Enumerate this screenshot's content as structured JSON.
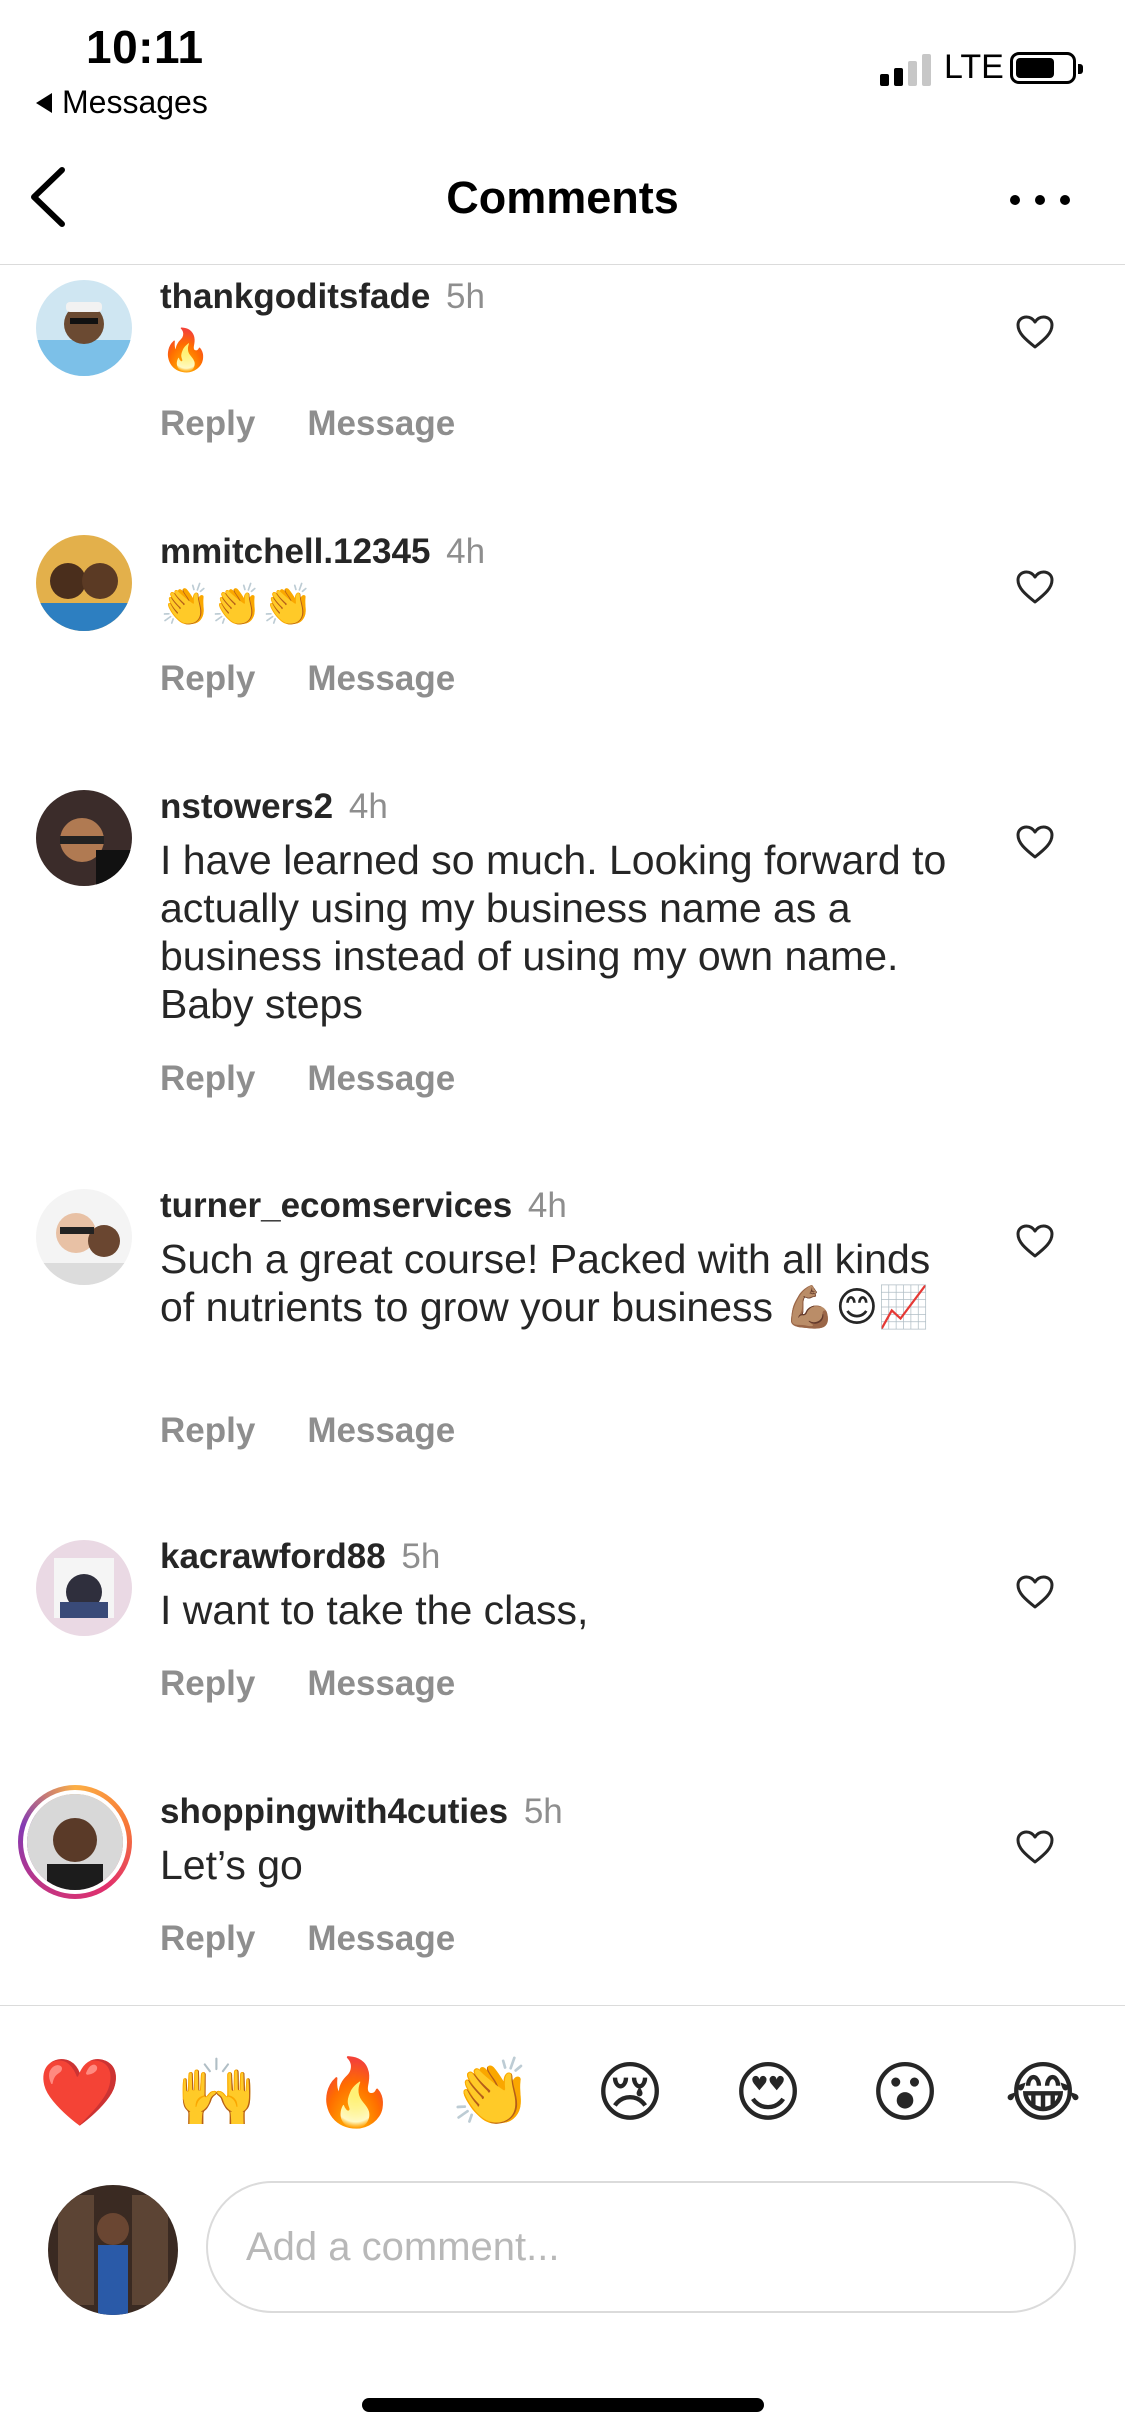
{
  "status_bar": {
    "time": "10:11",
    "back_app": "Messages",
    "network": "LTE",
    "signal_bars": 2
  },
  "nav": {
    "title": "Comments"
  },
  "comments": [
    {
      "username": "thankgoditsfade",
      "time": "5h",
      "text": "🔥",
      "reply": "Reply",
      "message": "Message"
    },
    {
      "username": "mmitchell.12345",
      "time": "4h",
      "text": "👏👏👏",
      "reply": "Reply",
      "message": "Message"
    },
    {
      "username": "nstowers2",
      "time": "4h",
      "text": "I have learned so much. Looking forward to actually using my business name as a business instead of using my own name. Baby steps",
      "reply": "Reply",
      "message": "Message"
    },
    {
      "username": "turner_ecomservices",
      "time": "4h",
      "text": "Such a great course! Packed with all kinds of nutrients to grow your business 💪🏽😊📈",
      "reply": "Reply",
      "message": "Message"
    },
    {
      "username": "kacrawford88",
      "time": "5h",
      "text": "I want to take the class,",
      "reply": "Reply",
      "message": "Message"
    },
    {
      "username": "shoppingwith4cuties",
      "time": "5h",
      "text": "Let’s go",
      "reply": "Reply",
      "message": "Message"
    }
  ],
  "quick_reactions": [
    "❤️",
    "🙌",
    "🔥",
    "👏",
    "😢",
    "😍",
    "😮",
    "😂"
  ],
  "composer": {
    "placeholder": "Add a comment..."
  },
  "colors": {
    "text": "#262626",
    "secondary": "#8e8e8e",
    "divider": "#dbdbdb"
  }
}
